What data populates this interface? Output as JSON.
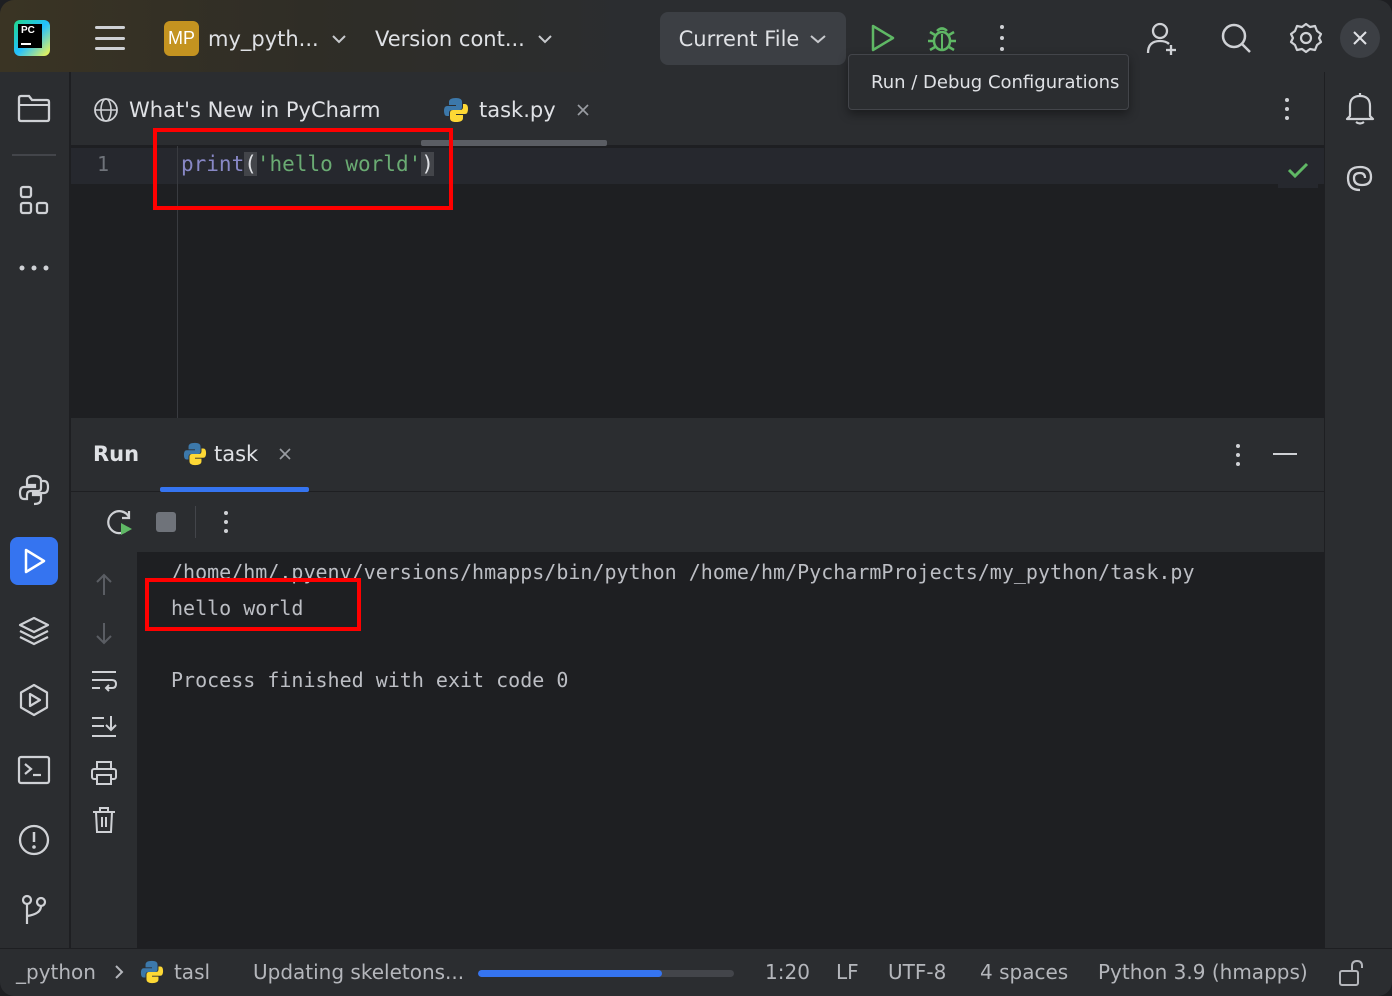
{
  "titlebar": {
    "logo_text": "PC",
    "project_badge": "MP",
    "project_name": "my_pyth...",
    "vcs_label": "Version cont...",
    "run_config": "Current File",
    "tooltip": "Run / Debug Configurations"
  },
  "editor": {
    "tabs": [
      {
        "label": "What's New in PyCharm",
        "icon": "globe-icon"
      },
      {
        "label": "task.py",
        "icon": "python-icon",
        "active": true
      }
    ],
    "line_number": "1",
    "code": {
      "fn": "print",
      "open_paren": "(",
      "string": "'hello world'",
      "close_paren": ")"
    }
  },
  "run_panel": {
    "title": "Run",
    "tab_label": "task",
    "console": {
      "command": "/home/hm/.pyenv/versions/hmapps/bin/python /home/hm/PycharmProjects/my_python/task.py",
      "output": "hello world",
      "exit_message": "Process finished with exit code 0"
    }
  },
  "statusbar": {
    "breadcrumb_project": "_python",
    "breadcrumb_file": "tasl",
    "task_text": "Updating skeletons...",
    "progress": 0.72,
    "position": "1:20",
    "line_ending": "LF",
    "encoding": "UTF-8",
    "indent": "4 spaces",
    "interpreter": "Python 3.9 (hmapps)"
  },
  "colors": {
    "accent": "#3574f0",
    "run_green": "#5fb865",
    "highlight": "#ff0000",
    "project_badge": "#c49320"
  }
}
